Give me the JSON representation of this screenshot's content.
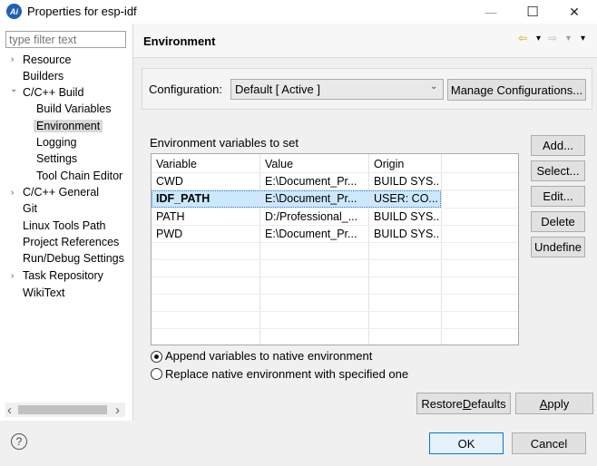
{
  "window": {
    "title": "Properties for esp-idf",
    "app_icon_text": "Ai",
    "minimize": "—",
    "maximize": "☐",
    "close": "✕"
  },
  "sidebar": {
    "filter_placeholder": "type filter text",
    "items": [
      {
        "label": "Resource",
        "arrow": "›"
      },
      {
        "label": "Builders",
        "arrow": ""
      },
      {
        "label": "C/C++ Build",
        "arrow": "⌄"
      },
      {
        "label": "Build Variables",
        "arrow": ""
      },
      {
        "label": "Environment",
        "arrow": ""
      },
      {
        "label": "Logging",
        "arrow": ""
      },
      {
        "label": "Settings",
        "arrow": ""
      },
      {
        "label": "Tool Chain Editor",
        "arrow": ""
      },
      {
        "label": "C/C++ General",
        "arrow": "›"
      },
      {
        "label": "Git",
        "arrow": ""
      },
      {
        "label": "Linux Tools Path",
        "arrow": ""
      },
      {
        "label": "Project References",
        "arrow": ""
      },
      {
        "label": "Run/Debug Settings",
        "arrow": ""
      },
      {
        "label": "Task Repository",
        "arrow": "›"
      },
      {
        "label": "WikiText",
        "arrow": ""
      }
    ],
    "scroll_left": "‹",
    "scroll_right": "›"
  },
  "page": {
    "title": "Environment",
    "nav_back": "⇦",
    "nav_back_menu": "▾",
    "nav_forward": "⇨",
    "nav_forward_menu": "▾",
    "view_menu": "▾"
  },
  "config": {
    "label": "Configuration:",
    "value": "Default  [ Active ]",
    "manage_button": "Manage Configurations..."
  },
  "env": {
    "label": "Environment variables to set",
    "columns": [
      "Variable",
      "Value",
      "Origin"
    ],
    "rows": [
      {
        "variable": "CWD",
        "value": "E:\\Document_Pr...",
        "origin": "BUILD SYS..."
      },
      {
        "variable": "IDF_PATH",
        "value": "E:\\Document_Pr...",
        "origin": "USER: CO..."
      },
      {
        "variable": "PATH",
        "value": "D:/Professional_...",
        "origin": "BUILD SYS..."
      },
      {
        "variable": "PWD",
        "value": "E:\\Document_Pr...",
        "origin": "BUILD SYS..."
      }
    ],
    "buttons": {
      "add": "Add...",
      "select": "Select...",
      "edit": "Edit...",
      "delete": "Delete",
      "undefine": "Undefine"
    }
  },
  "options": {
    "append": "Append variables to native environment",
    "replace": "Replace native environment with specified one"
  },
  "actions": {
    "restore_prefix": "Restore ",
    "restore_mnemonic": "D",
    "restore_suffix": "efaults",
    "apply_mnemonic": "A",
    "apply_suffix": "pply",
    "ok": "OK",
    "cancel": "Cancel",
    "help": "?"
  }
}
